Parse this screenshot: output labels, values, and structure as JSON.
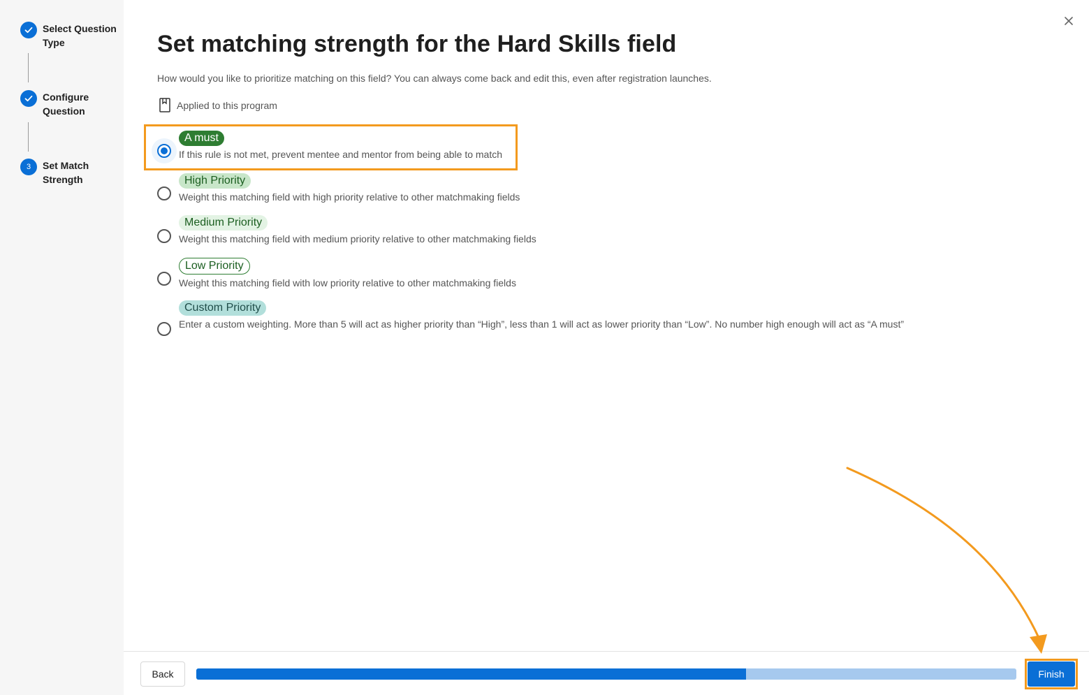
{
  "sidebar": {
    "steps": [
      {
        "label": "Select Question Type",
        "state": "complete"
      },
      {
        "label": "Configure Question",
        "state": "complete"
      },
      {
        "label": "Set Match Strength",
        "state": "current",
        "number": "3"
      }
    ]
  },
  "main": {
    "title": "Set matching strength for the Hard Skills field",
    "subtitle": "How would you like to prioritize matching on this field? You can always come back and edit this, even after registration launches.",
    "applied_label": "Applied to this program",
    "options": [
      {
        "chip": "A must",
        "description": "If this rule is not met, prevent mentee and mentor from being able to match",
        "selected": true
      },
      {
        "chip": "High Priority",
        "description": "Weight this matching field with high priority relative to other matchmaking fields",
        "selected": false
      },
      {
        "chip": "Medium Priority",
        "description": "Weight this matching field with medium priority relative to other matchmaking fields",
        "selected": false
      },
      {
        "chip": "Low Priority",
        "description": "Weight this matching field with low priority relative to other matchmaking fields",
        "selected": false
      },
      {
        "chip": "Custom Priority",
        "description": "Enter a custom weighting. More than 5 will act as higher priority than “High”, less than 1 will act as lower priority than “Low”. No number high enough will act as “A must”",
        "selected": false
      }
    ]
  },
  "footer": {
    "back_label": "Back",
    "finish_label": "Finish",
    "progress_fraction": 0.67
  },
  "colors": {
    "accent": "#0a6fd6",
    "annotation": "#f39a1e"
  }
}
